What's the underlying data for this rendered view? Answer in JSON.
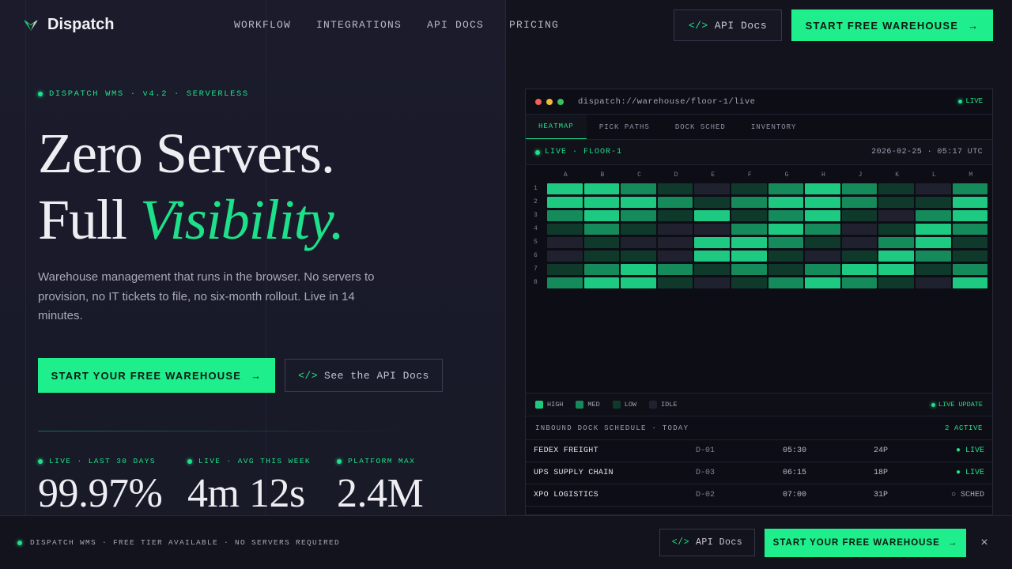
{
  "header": {
    "logo_text": "Dispatch",
    "nav": [
      "WORKFLOW",
      "INTEGRATIONS",
      "API DOCS",
      "PRICING"
    ],
    "api_button": "API Docs",
    "api_icon": "</>",
    "start_button": "START FREE WAREHOUSE",
    "arrow": "→"
  },
  "hero": {
    "eyebrow": "DISPATCH WMS · v4.2 · SERVERLESS",
    "headline_line1": "Zero Servers.",
    "headline_line2_plain": "Full ",
    "headline_line2_accent": "Visibility.",
    "lede": "Warehouse management that runs in the browser. No servers to provision, no IT tickets to file, no six-month rollout. Live in 14 minutes.",
    "cta_primary": "START YOUR FREE WAREHOUSE",
    "cta_secondary": "See the API Docs",
    "stats": [
      {
        "label": "LIVE · LAST 30 DAYS",
        "value": "99.97%"
      },
      {
        "label": "LIVE · AVG THIS WEEK",
        "value": "4m 12s"
      },
      {
        "label": "PLATFORM MAX",
        "value": "2.4M"
      }
    ]
  },
  "dashboard": {
    "url": "dispatch://warehouse/floor-1/live",
    "live_badge": "LIVE",
    "tabs": [
      "HEATMAP",
      "PICK PATHS",
      "DOCK SCHED",
      "INVENTORY"
    ],
    "floor_label": "LIVE · FLOOR-1",
    "timestamp": "2026-02-25 · 05:17 UTC",
    "columns": [
      "A",
      "B",
      "C",
      "D",
      "E",
      "F",
      "G",
      "H",
      "J",
      "K",
      "L",
      "M"
    ],
    "rows": [
      "1",
      "2",
      "3",
      "4",
      "5",
      "6",
      "7",
      "8"
    ],
    "heat_levels": [
      [
        3,
        3,
        2,
        1,
        0,
        1,
        2,
        3,
        2,
        1,
        0,
        2
      ],
      [
        3,
        3,
        3,
        2,
        1,
        2,
        3,
        3,
        2,
        1,
        1,
        3
      ],
      [
        2,
        3,
        2,
        1,
        3,
        1,
        2,
        3,
        1,
        0,
        2,
        3
      ],
      [
        1,
        2,
        1,
        0,
        0,
        2,
        3,
        2,
        0,
        1,
        3,
        2
      ],
      [
        0,
        1,
        0,
        0,
        3,
        3,
        2,
        1,
        0,
        2,
        3,
        1
      ],
      [
        0,
        1,
        1,
        0,
        3,
        3,
        1,
        0,
        1,
        3,
        2,
        1
      ],
      [
        1,
        2,
        3,
        2,
        1,
        2,
        1,
        2,
        3,
        3,
        1,
        2
      ],
      [
        2,
        3,
        3,
        1,
        0,
        1,
        2,
        3,
        2,
        1,
        0,
        3
      ]
    ],
    "legend": [
      "HIGH",
      "MED",
      "LOW",
      "IDLE"
    ],
    "legend_colors": [
      "#1ec982",
      "#158a5a",
      "#0f3a2b",
      "#20212e"
    ],
    "live_update": "LIVE UPDATE",
    "schedule_title": "INBOUND DOCK SCHEDULE · TODAY",
    "schedule_count": "2 ACTIVE",
    "schedule": [
      {
        "carrier": "FEDEX FREIGHT",
        "dock": "D-01",
        "time": "05:30",
        "pallets": "24P",
        "status": "● LIVE"
      },
      {
        "carrier": "UPS SUPPLY CHAIN",
        "dock": "D-03",
        "time": "06:15",
        "pallets": "18P",
        "status": "● LIVE"
      },
      {
        "carrier": "XPO LOGISTICS",
        "dock": "D-02",
        "time": "07:00",
        "pallets": "31P",
        "status": "○ SCHED"
      }
    ]
  },
  "bottom_bar": {
    "message": "DISPATCH WMS · FREE TIER AVAILABLE · NO SERVERS REQUIRED",
    "api_button": "API Docs",
    "start_button": "START YOUR FREE WAREHOUSE",
    "close": "×"
  },
  "colors": {
    "accent": "#1fee8c",
    "background": "#13131d"
  }
}
